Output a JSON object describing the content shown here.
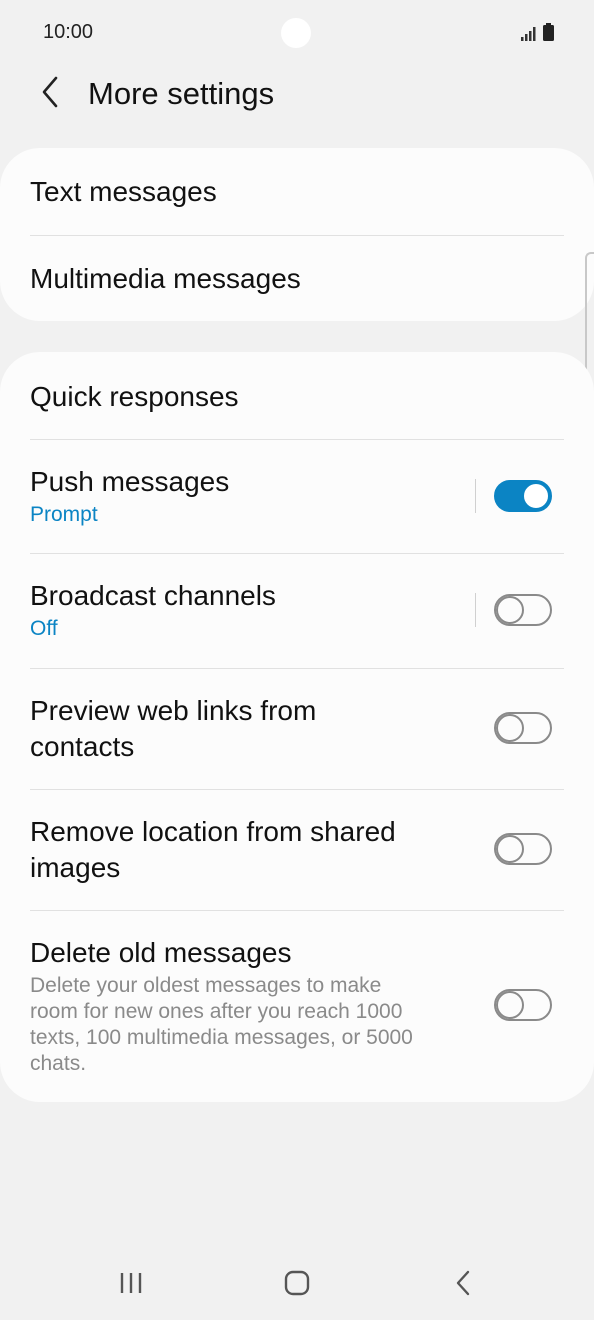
{
  "status_bar": {
    "time": "10:00"
  },
  "header": {
    "title": "More settings"
  },
  "card1": {
    "items": [
      {
        "label": "Text messages"
      },
      {
        "label": "Multimedia messages"
      }
    ]
  },
  "card2": {
    "quick_responses": {
      "label": "Quick responses"
    },
    "push_messages": {
      "label": "Push messages",
      "sub": "Prompt",
      "toggle": true
    },
    "broadcast_channels": {
      "label": "Broadcast channels",
      "sub": "Off",
      "toggle": false
    },
    "preview_web_links": {
      "label_line1": "Preview web links from",
      "label_line2": "contacts",
      "toggle": false
    },
    "remove_location": {
      "label_line1": "Remove location from shared",
      "label_line2": "images",
      "toggle": false
    },
    "delete_old": {
      "label": "Delete old messages",
      "desc_line1": "Delete your oldest messages to make",
      "desc_line2": "room for new ones after you reach 1000",
      "desc_line3": "texts, 100 multimedia messages, or 5000",
      "desc_line4": "chats.",
      "toggle": false
    }
  },
  "colors": {
    "accent": "#0b84c4",
    "background": "#f1f1f1",
    "card": "#fcfcfc"
  },
  "icons": {
    "back": "chevron-left-icon",
    "signal": "signal-icon",
    "battery": "battery-icon",
    "recents": "recents-icon",
    "home": "home-icon",
    "nav_back": "nav-back-icon"
  }
}
